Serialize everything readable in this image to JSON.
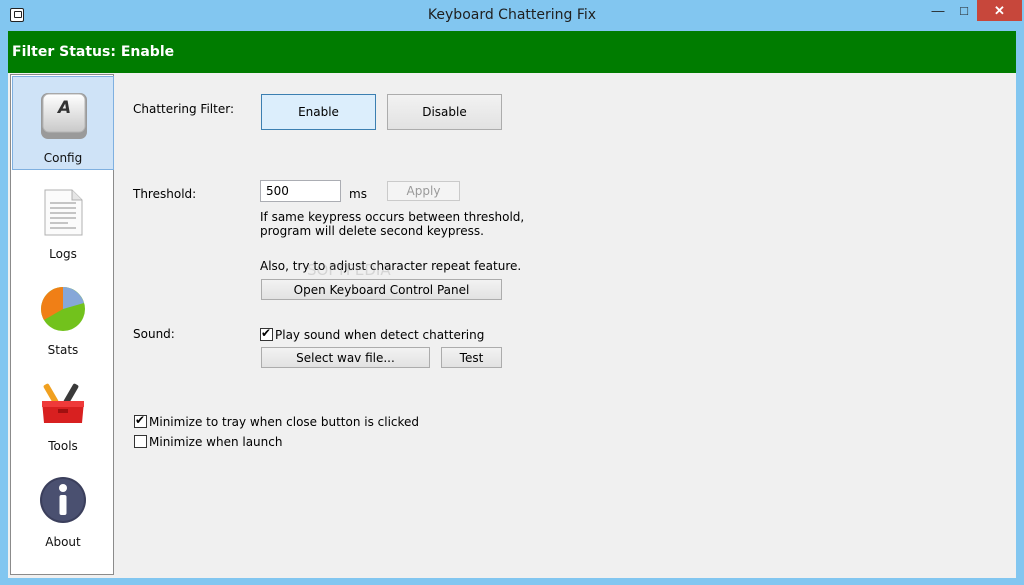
{
  "window": {
    "title": "Keyboard Chattering Fix"
  },
  "status": {
    "text": "Filter Status: Enable",
    "color": "#007c00"
  },
  "sidebar": {
    "items": [
      {
        "label": "Config",
        "icon": "keyboard-key-icon"
      },
      {
        "label": "Logs",
        "icon": "document-icon"
      },
      {
        "label": "Stats",
        "icon": "pie-chart-icon"
      },
      {
        "label": "Tools",
        "icon": "toolbox-icon"
      },
      {
        "label": "About",
        "icon": "info-icon"
      }
    ]
  },
  "config": {
    "chattering_filter_label": "Chattering Filter:",
    "enable_label": "Enable",
    "disable_label": "Disable",
    "threshold_label": "Threshold:",
    "threshold_value": "500",
    "threshold_unit": "ms",
    "apply_label": "Apply",
    "threshold_help_1": "If same keypress occurs between threshold,",
    "threshold_help_2": "program will delete second keypress.",
    "repeat_hint": "Also, try to adjust character repeat feature.",
    "open_panel_label": "Open Keyboard Control Panel",
    "sound_label": "Sound:",
    "play_sound_label": "Play sound when detect chattering",
    "play_sound_checked": true,
    "select_wav_label": "Select wav file...",
    "test_label": "Test",
    "minimize_tray_label": "Minimize to tray when close button is clicked",
    "minimize_tray_checked": true,
    "minimize_launch_label": "Minimize when launch",
    "minimize_launch_checked": false
  },
  "watermark": "SOFTPEDIA"
}
